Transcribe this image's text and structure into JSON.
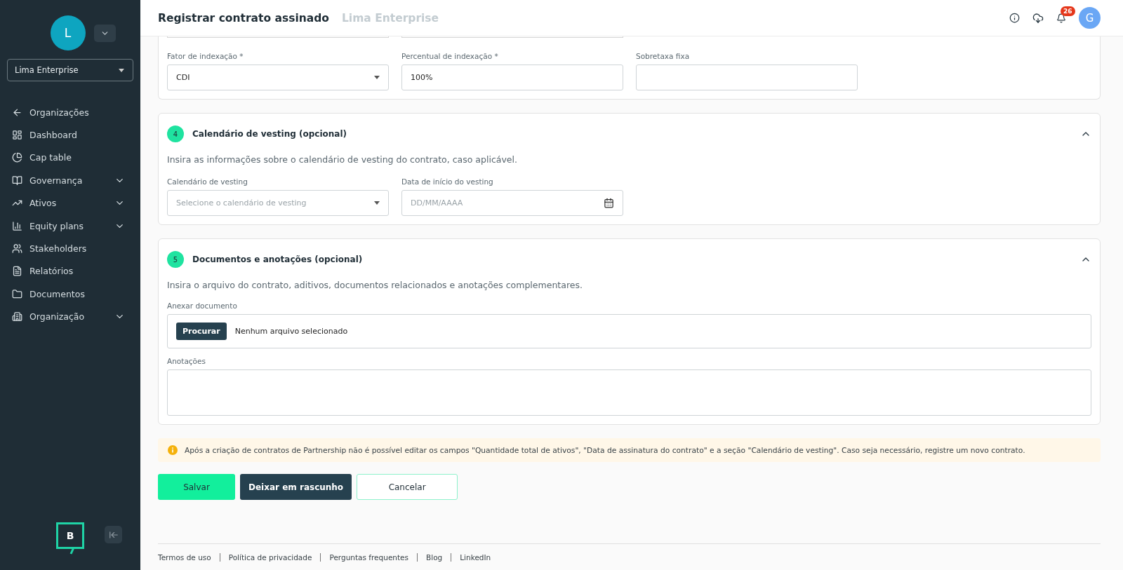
{
  "sidebar": {
    "avatar_letter": "L",
    "org_select": {
      "value": "Lima Enterprise"
    },
    "nav": [
      {
        "label": "Organizações",
        "expandable": false
      },
      {
        "label": "Dashboard",
        "expandable": false
      },
      {
        "label": "Cap table",
        "expandable": false
      },
      {
        "label": "Governança",
        "expandable": true
      },
      {
        "label": "Ativos",
        "expandable": true
      },
      {
        "label": "Equity plans",
        "expandable": true
      },
      {
        "label": "Stakeholders",
        "expandable": false
      },
      {
        "label": "Relatórios",
        "expandable": false
      },
      {
        "label": "Documentos",
        "expandable": false
      },
      {
        "label": "Organização",
        "expandable": true
      }
    ],
    "logo_letter": "B"
  },
  "header": {
    "title": "Registrar contrato assinado",
    "subtitle": "Lima Enterprise",
    "notification_count": "26",
    "user_initial": "G"
  },
  "partial_section": {
    "fields": [
      {
        "kind": "select",
        "label": "Fator de indexação *",
        "value": "CDI"
      },
      {
        "kind": "text",
        "label": "Percentual de indexação *",
        "value": "100%"
      },
      {
        "kind": "text",
        "label": "Sobretaxa fixa"
      }
    ]
  },
  "sections": [
    {
      "number": "4",
      "title": "Calendário de vesting (opcional)",
      "expanded": true,
      "description": "Insira as informações sobre o calendário de vesting do contrato, caso aplicável.",
      "fields": [
        {
          "kind": "select",
          "label": "Calendário de vesting",
          "placeholder": "Selecione o calendário de vesting"
        },
        {
          "kind": "date",
          "label": "Data de início do vesting",
          "placeholder": "DD/MM/AAAA"
        }
      ]
    },
    {
      "number": "5",
      "title": "Documentos e anotações (opcional)",
      "expanded": true,
      "description": "Insira o arquivo do contrato, aditivos, documentos relacionados e anotações complementares.",
      "fields": [
        {
          "kind": "file",
          "label": "Anexar documento",
          "button": "Procurar",
          "value": "Nenhum arquivo selecionado"
        },
        {
          "kind": "textarea",
          "label": "Anotações"
        }
      ]
    }
  ],
  "alert": "Após a criação de contratos de Partnership não é possível editar os campos \"Quantidade total de ativos\", \"Data de assinatura do contrato\" e a seção \"Calendário de vesting\". Caso seja necessário, registre um novo contrato.",
  "buttons": [
    {
      "kind": "primary",
      "label": "Salvar"
    },
    {
      "kind": "dark",
      "label": "Deixar em rascunho"
    },
    {
      "kind": "outline",
      "label": "Cancelar"
    }
  ],
  "footer_links": [
    "Termos de uso",
    "Política de privacidade",
    "Perguntas frequentes",
    "Blog",
    "LinkedIn"
  ]
}
